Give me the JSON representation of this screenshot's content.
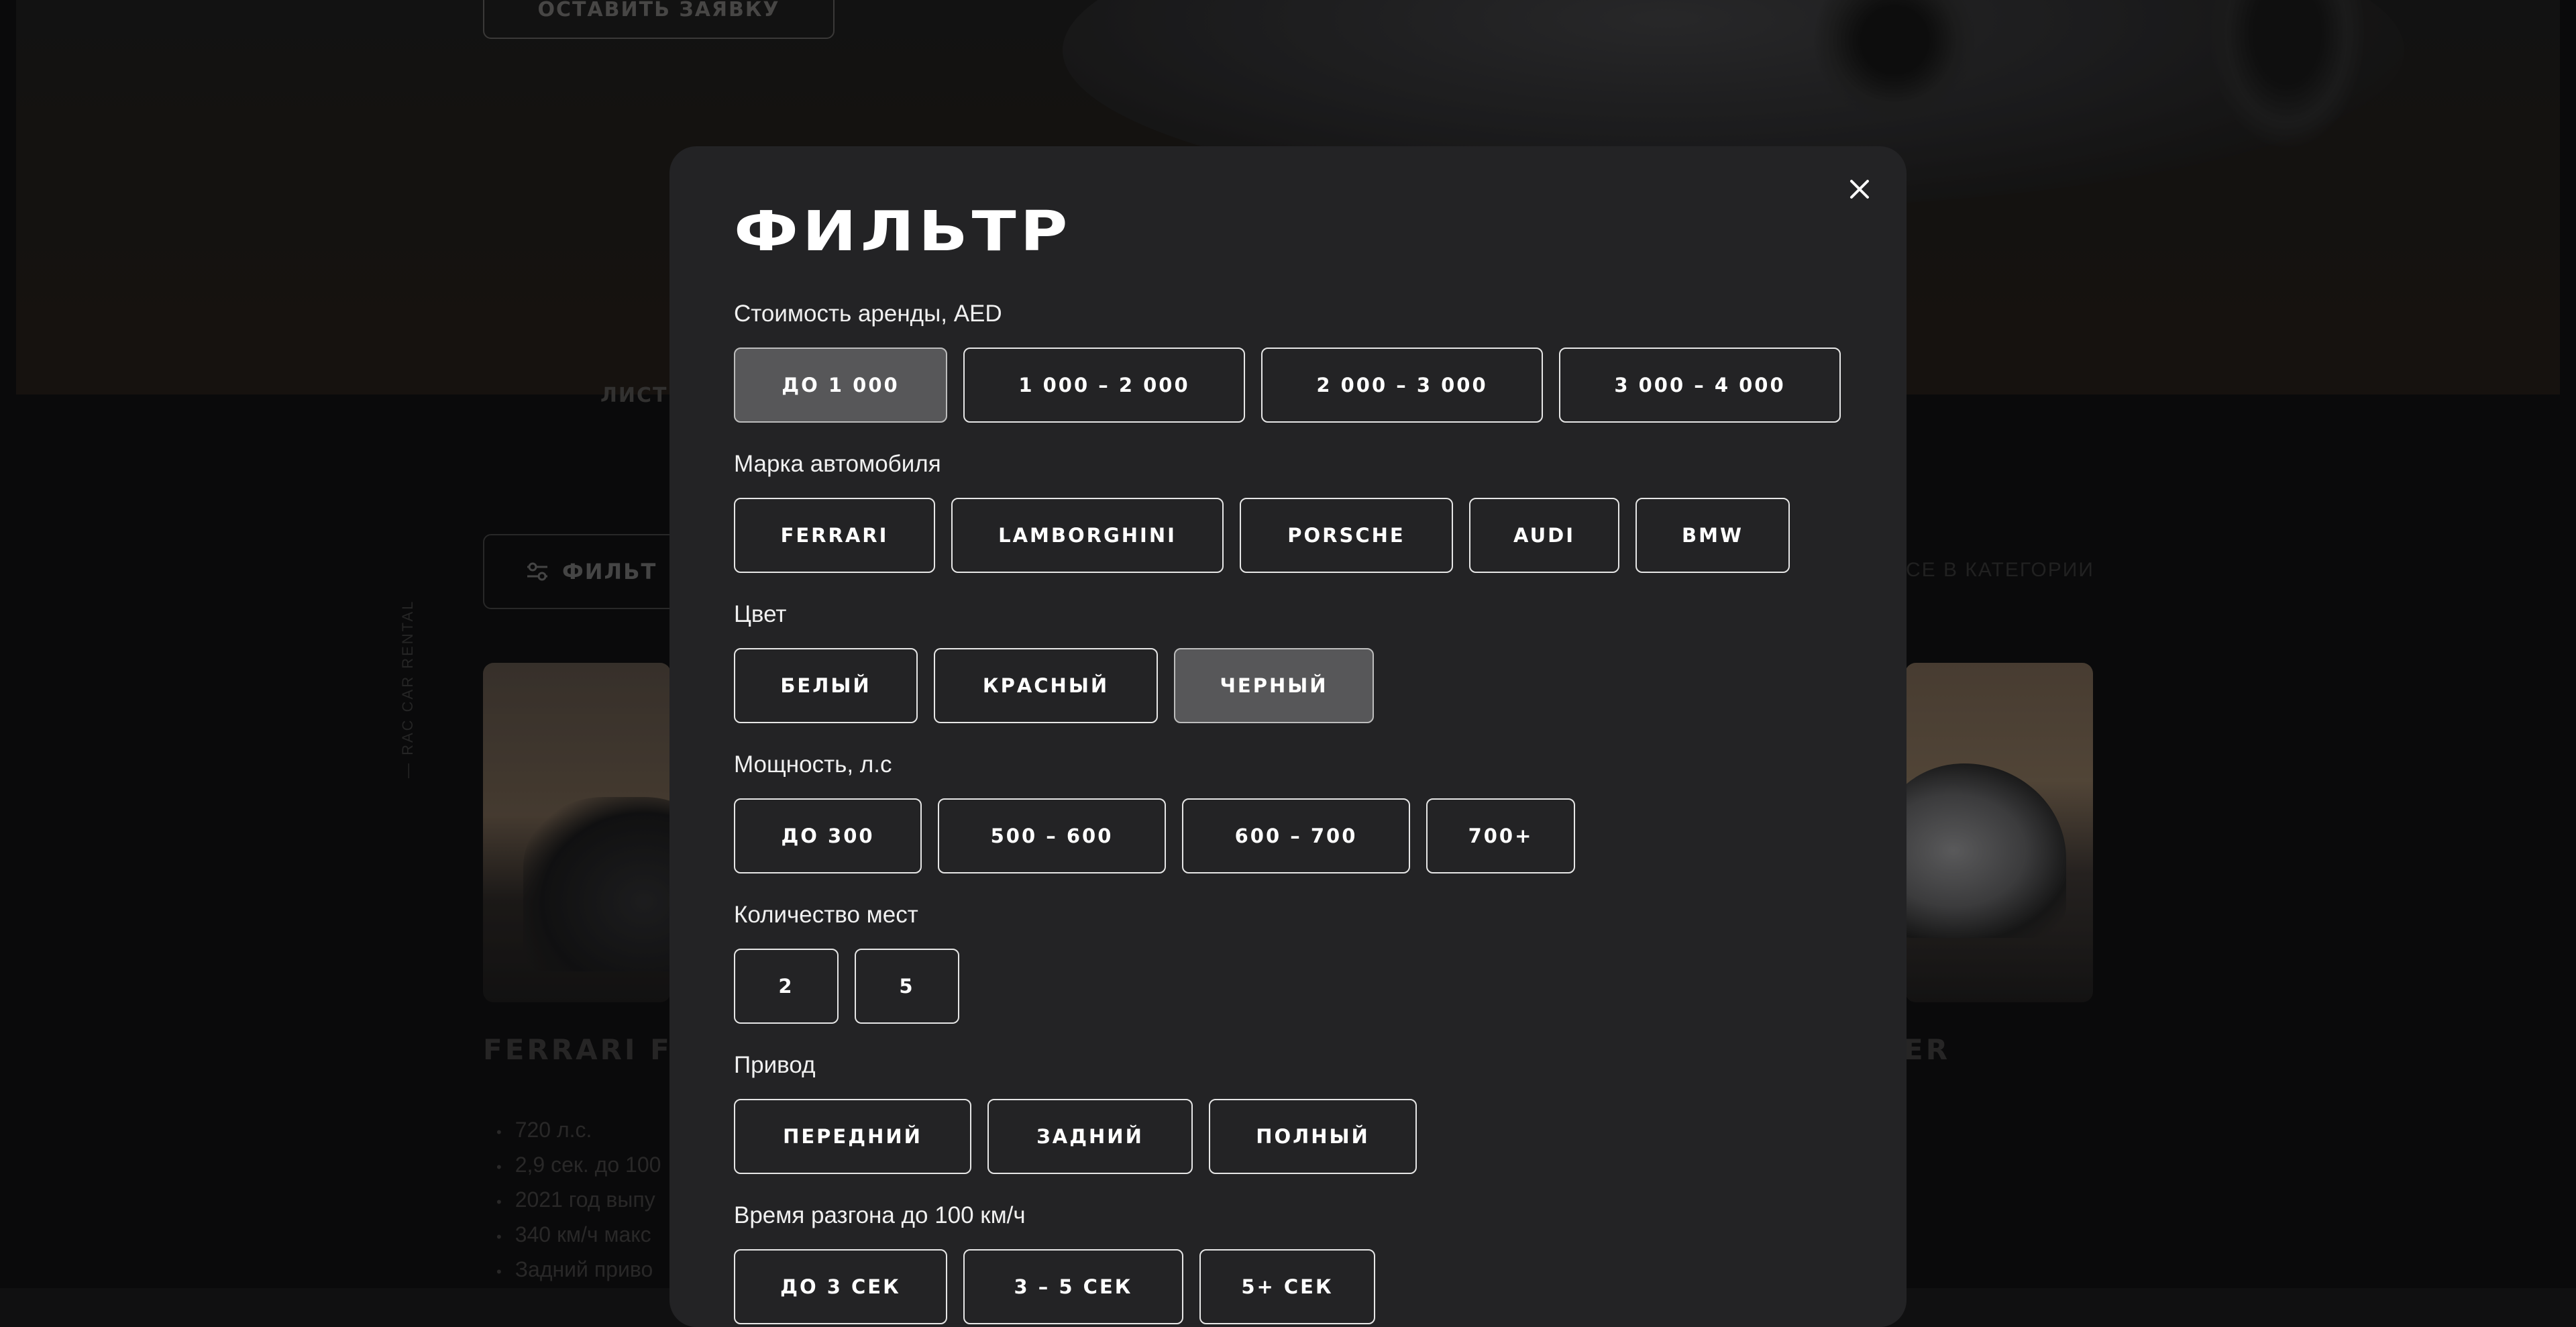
{
  "background": {
    "hero_button_label": "ОСТАВИТЬ ЗАЯВКУ",
    "tab_label": "ЛИСТ",
    "vertical_text": "— RAC CAR RENTAL",
    "filter_button_label": "ФИЛЬТ",
    "category_link": "ВСЕ В КАТЕГОРИИ",
    "card_left_title": "FERRARI F",
    "card_right_title": "ER",
    "card_left_specs": [
      "720 л.с.",
      "2,9 сек. до 100",
      "2021 год выпу",
      "340 км/ч макс",
      "Задний приво"
    ]
  },
  "modal": {
    "title": "ФИЛЬТР",
    "close_icon": "close-icon",
    "groups": [
      {
        "label": "Стоимость аренды, AED",
        "options": [
          {
            "label": "ДО 1 000",
            "active": true
          },
          {
            "label": "1 000 – 2 000",
            "active": false
          },
          {
            "label": "2 000 – 3 000",
            "active": false
          },
          {
            "label": "3 000 – 4 000",
            "active": false
          }
        ]
      },
      {
        "label": "Марка автомобиля",
        "options": [
          {
            "label": "FERRARI",
            "active": false
          },
          {
            "label": "LAMBORGHINI",
            "active": false
          },
          {
            "label": "PORSCHE",
            "active": false
          },
          {
            "label": "AUDI",
            "active": false
          },
          {
            "label": "BMW",
            "active": false
          }
        ]
      },
      {
        "label": "Цвет",
        "options": [
          {
            "label": "БЕЛЫЙ",
            "active": false
          },
          {
            "label": "КРАСНЫЙ",
            "active": false
          },
          {
            "label": "ЧЕРНЫЙ",
            "active": true
          }
        ]
      },
      {
        "label": "Мощность, л.с",
        "options": [
          {
            "label": "ДО 300",
            "active": false
          },
          {
            "label": "500 – 600",
            "active": false
          },
          {
            "label": "600 – 700",
            "active": false
          },
          {
            "label": "700+",
            "active": false
          }
        ]
      },
      {
        "label": "Количество мест",
        "options": [
          {
            "label": "2",
            "active": false
          },
          {
            "label": "5",
            "active": false
          }
        ]
      },
      {
        "label": "Привод",
        "options": [
          {
            "label": "ПЕРЕДНИЙ",
            "active": false
          },
          {
            "label": "ЗАДНИЙ",
            "active": false
          },
          {
            "label": "ПОЛНЫЙ",
            "active": false
          }
        ]
      },
      {
        "label": "Время разгона до 100 км/ч",
        "options": [
          {
            "label": "ДО 3 СЕК",
            "active": false
          },
          {
            "label": "3 – 5 СЕК",
            "active": false
          },
          {
            "label": "5+ СЕК",
            "active": false
          }
        ]
      }
    ]
  }
}
